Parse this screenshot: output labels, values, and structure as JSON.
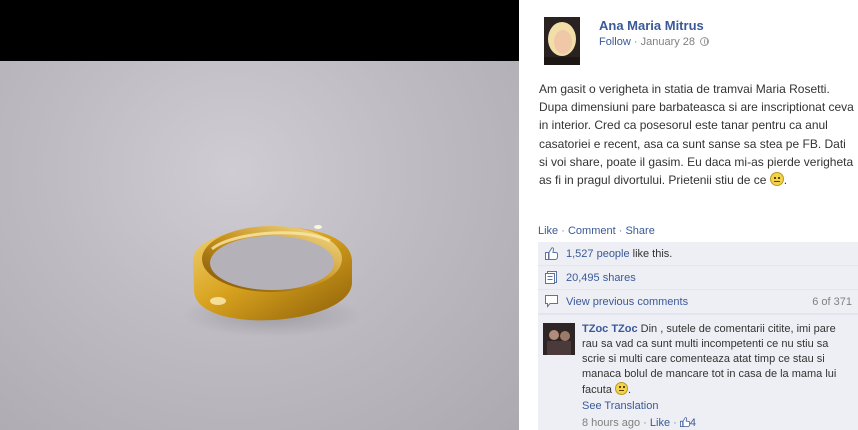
{
  "post": {
    "author": "Ana Maria Mitrus",
    "follow_label": "Follow",
    "date": "January 28",
    "caption": "Am gasit o verigheta in statia de tramvai Maria Rosetti. Dupa dimensiuni pare barbateasca si are inscriptionat ceva in interior. Cred ca posesorul este tanar pentru ca anul casatoriei e recent, asa ca sunt sanse sa stea pe FB. Dati si voi share, poate il gasim. Eu daca mi-as pierde verigheta as fi in pragul divortului. Prietenii stiu de ce",
    "caption_end": "."
  },
  "actions": {
    "like": "Like",
    "comment": "Comment",
    "share": "Share",
    "separator": "·"
  },
  "stats": {
    "likes_link": "1,527 people",
    "likes_text": "like this.",
    "shares": "20,495 shares",
    "view_previous": "View previous comments",
    "comments_count": "6 of 371"
  },
  "comment": {
    "author": "TZoc TZoc",
    "text": "Din , sutele de comentarii citite, imi pare rau sa vad ca sunt multi incompetenti ce nu stiu sa scrie si multi care comenteaza atat timp ce stau si manaca bolul de mancare tot in casa de la mama lui facuta",
    "see_translation": "See Translation",
    "time": "8 hours ago",
    "like": "Like",
    "like_count": "4",
    "separator": "·"
  },
  "icons": {
    "globe": "globe-icon",
    "smiley": "smiley-icon",
    "thumbs_up": "thumbs-up-icon",
    "shares": "shares-icon",
    "comments": "comments-icon"
  },
  "colors": {
    "link": "#3b5998",
    "ufi_background": "#edeff4",
    "photo_letterbox": "#000000",
    "ring_gold": "#d8a21e"
  }
}
